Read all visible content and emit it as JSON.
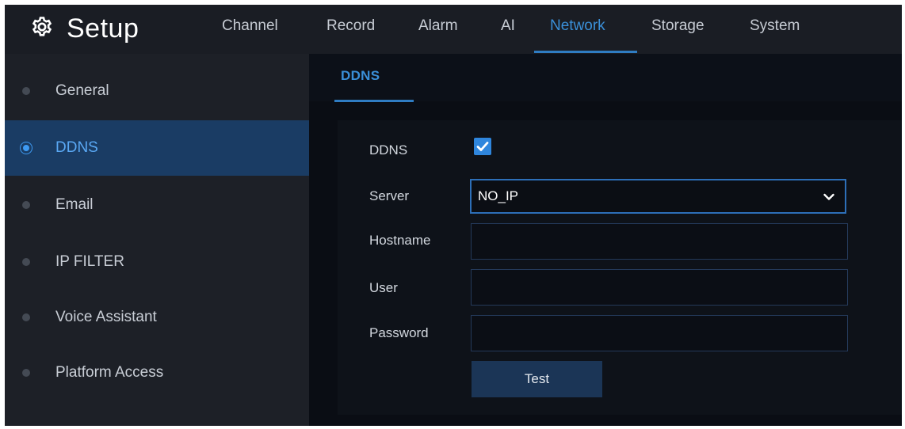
{
  "header": {
    "title": "Setup",
    "icon": "gear-icon",
    "tabs": [
      {
        "label": "Channel"
      },
      {
        "label": "Record"
      },
      {
        "label": "Alarm"
      },
      {
        "label": "AI"
      },
      {
        "label": "Network"
      },
      {
        "label": "Storage"
      },
      {
        "label": "System"
      }
    ],
    "active_tab": "Network"
  },
  "sidebar": {
    "items": [
      {
        "label": "General"
      },
      {
        "label": "DDNS"
      },
      {
        "label": "Email"
      },
      {
        "label": "IP FILTER"
      },
      {
        "label": "Voice Assistant"
      },
      {
        "label": "Platform Access"
      }
    ],
    "active_item": "DDNS"
  },
  "content": {
    "subtab": "DDNS",
    "form": {
      "ddns_label": "DDNS",
      "ddns_enabled": true,
      "server_label": "Server",
      "server_value": "NO_IP",
      "hostname_label": "Hostname",
      "hostname_value": "",
      "user_label": "User",
      "user_value": "",
      "password_label": "Password",
      "password_value": "",
      "test_label": "Test"
    }
  },
  "colors": {
    "accent": "#3a8fd8",
    "active_sidebar_bg": "#1a3c64",
    "checkbox": "#2f86dd",
    "background": "#0a0d14"
  }
}
